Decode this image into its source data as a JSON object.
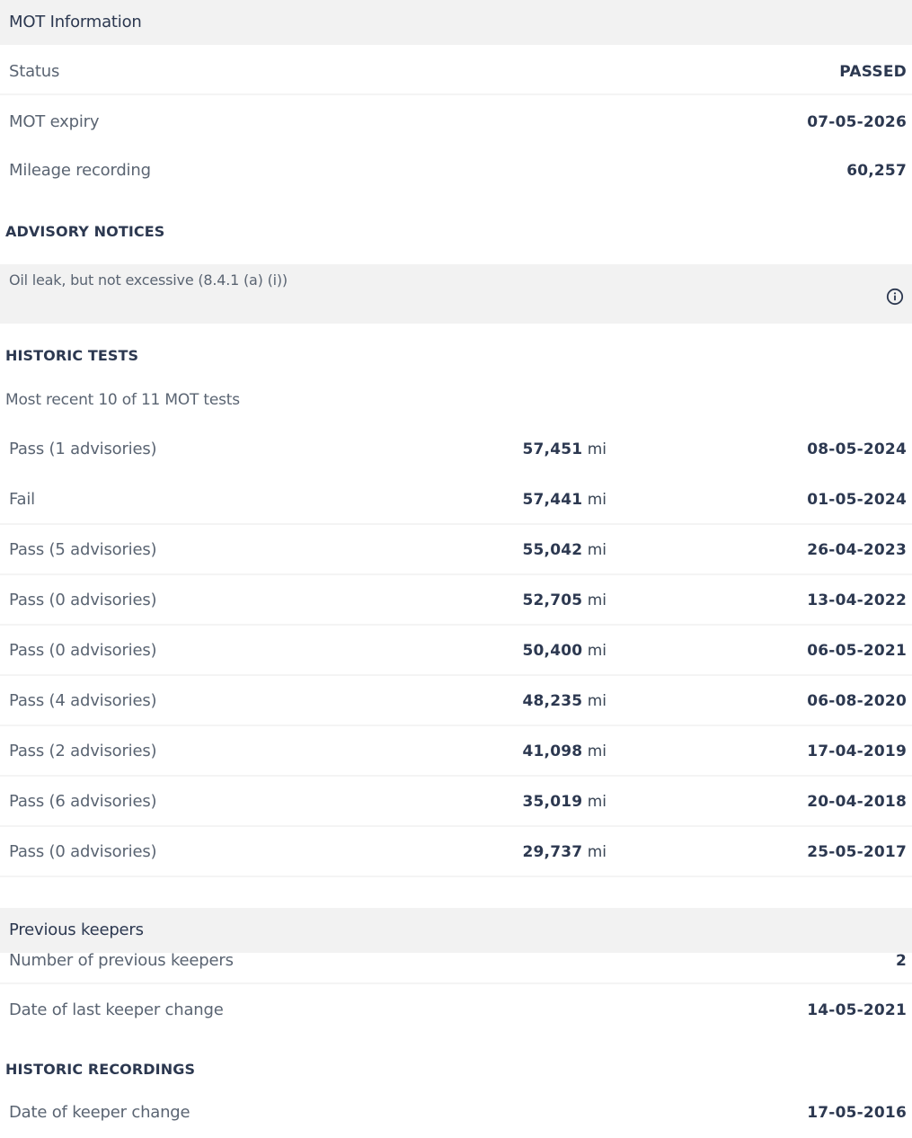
{
  "mot": {
    "header": "MOT Information",
    "rows": [
      {
        "label": "Status",
        "value": "PASSED"
      },
      {
        "label": "MOT expiry",
        "value": "07-05-2026"
      },
      {
        "label": "Mileage recording",
        "value": "60,257"
      }
    ]
  },
  "advisory": {
    "heading": "ADVISORY NOTICES",
    "notice": "Oil leak, but not excessive (8.4.1 (a) (i))",
    "icon": "info-icon"
  },
  "historic_tests": {
    "heading": "HISTORIC TESTS",
    "summary": "Most recent 10 of 11 MOT tests",
    "unit": "mi",
    "tests": [
      {
        "result": "Pass (1 advisories)",
        "mileage": "57,451",
        "date": "08-05-2024"
      },
      {
        "result": "Fail",
        "mileage": "57,441",
        "date": "01-05-2024"
      },
      {
        "result": "Pass (5 advisories)",
        "mileage": "55,042",
        "date": "26-04-2023"
      },
      {
        "result": "Pass (0 advisories)",
        "mileage": "52,705",
        "date": "13-04-2022"
      },
      {
        "result": "Pass (0 advisories)",
        "mileage": "50,400",
        "date": "06-05-2021"
      },
      {
        "result": "Pass (4 advisories)",
        "mileage": "48,235",
        "date": "06-08-2020"
      },
      {
        "result": "Pass (2 advisories)",
        "mileage": "41,098",
        "date": "17-04-2019"
      },
      {
        "result": "Pass (6 advisories)",
        "mileage": "35,019",
        "date": "20-04-2018"
      },
      {
        "result": "Pass (0 advisories)",
        "mileage": "29,737",
        "date": "25-05-2017"
      }
    ]
  },
  "keepers": {
    "header": "Previous keepers",
    "rows": [
      {
        "label": "Number of previous keepers",
        "value": "2"
      },
      {
        "label": "Date of last keeper change",
        "value": "14-05-2021"
      }
    ]
  },
  "historic_recordings": {
    "heading": "HISTORIC RECORDINGS",
    "rows": [
      {
        "label": "Date of keeper change",
        "value": "17-05-2016"
      }
    ]
  }
}
